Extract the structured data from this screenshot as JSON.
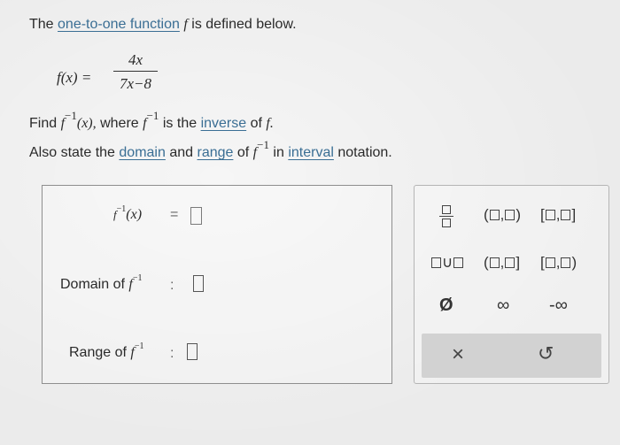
{
  "problem": {
    "intro_prefix": "The",
    "intro_link": "one-to-one function",
    "intro_var": "f",
    "intro_suffix": "is defined below.",
    "function_lhs": "f(x) =",
    "numerator": "4x",
    "denominator": "7x−8",
    "find_prefix": "Find",
    "f_symbol": "f",
    "inverse_exp": "−1",
    "find_arg": "(x),",
    "find_where": "where",
    "find_is_the": "is the",
    "inverse_link": "inverse",
    "find_of": "of",
    "find_f_end": "f.",
    "also_prefix": "Also state the",
    "domain_link": "domain",
    "and_text": "and",
    "range_link": "range",
    "of_text": "of",
    "in_text": "in",
    "interval_link": "interval",
    "notation_text": "notation."
  },
  "answer": {
    "inverse_label_f": "f",
    "inverse_label_exp": "−1",
    "inverse_label_arg": "(x)",
    "equals": "=",
    "domain_label": "Domain of",
    "range_label": "Range of",
    "colon": ":",
    "f_symbol": "f",
    "exp": "−1",
    "inverse_value": "",
    "domain_value": "",
    "range_value": ""
  },
  "palette": {
    "open_open_left": "(",
    "comma": ",",
    "open_open_right": ")",
    "closed_left": "[",
    "closed_right": "]",
    "union": "∪",
    "empty_set": "Ø",
    "infinity": "∞",
    "neg_infinity": "-∞",
    "clear": "×",
    "undo": "↺"
  }
}
